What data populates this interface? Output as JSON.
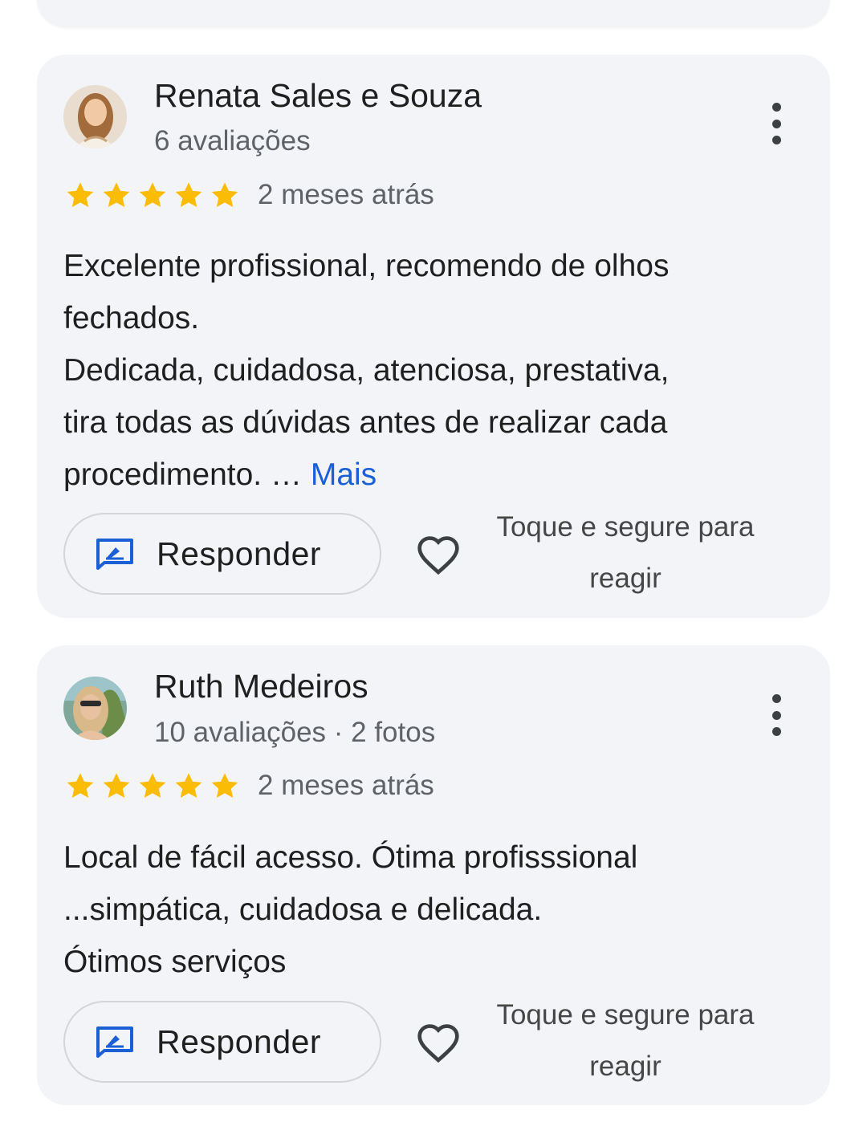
{
  "colors": {
    "card_background": "#f3f4f7",
    "star": "#fbbc04",
    "link": "#1a5fd6",
    "reply_icon": "#1a5fd6"
  },
  "reviews": [
    {
      "author": "Renata Sales e Souza",
      "meta": "6 avaliações",
      "rating": 5,
      "time": "2 meses atrás",
      "text_lines": [
        "Excelente profissional, recomendo de olhos",
        "fechados.",
        "Dedicada, cuidadosa, atenciosa, prestativa,",
        "tira todas as dúvidas antes de realizar cada",
        "procedimento. …"
      ],
      "more_label": "Mais",
      "reply_label": "Responder",
      "react_hint_line1": "Toque e segure para",
      "react_hint_line2": "reagir",
      "icons": [
        "avatar-photo",
        "more-vert-icon",
        "star-icon",
        "reply-icon",
        "heart-icon"
      ]
    },
    {
      "author": "Ruth Medeiros",
      "meta": "10 avaliações · 2 fotos",
      "rating": 5,
      "time": "2 meses atrás",
      "text_lines": [
        "Local de fácil acesso. Ótima profisssional",
        "...simpática, cuidadosa e delicada.",
        "Ótimos serviços"
      ],
      "reply_label": "Responder",
      "react_hint_line1": "Toque e segure para",
      "react_hint_line2": "reagir",
      "icons": [
        "avatar-photo",
        "more-vert-icon",
        "star-icon",
        "reply-icon",
        "heart-icon"
      ]
    }
  ]
}
